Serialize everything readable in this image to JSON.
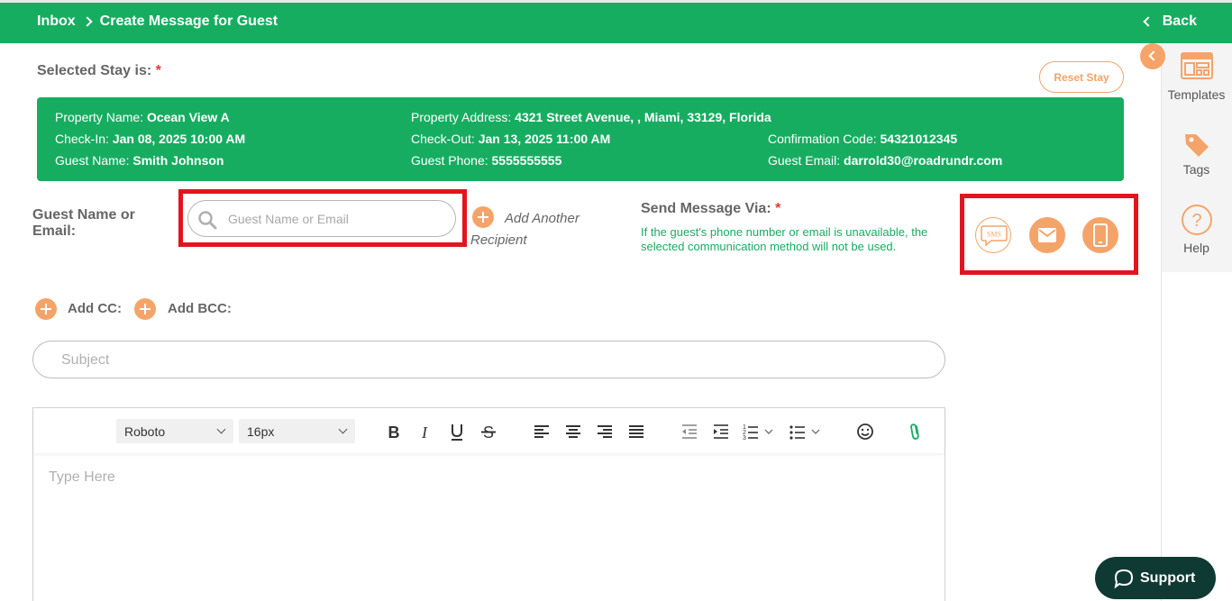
{
  "header": {
    "breadcrumb_root": "Inbox",
    "page_title": "Create Message for Guest",
    "back_label": "Back"
  },
  "sidebar": {
    "items": [
      {
        "label": "Templates",
        "icon": "templates-icon"
      },
      {
        "label": "Tags",
        "icon": "tag-icon"
      },
      {
        "label": "Help",
        "icon": "help-icon"
      }
    ]
  },
  "stay": {
    "selected_label": "Selected Stay is:",
    "required_mark": "*",
    "reset_label": "Reset Stay",
    "property_name_label": "Property Name:",
    "property_name": "Ocean View A",
    "property_address_label": "Property Address:",
    "property_address": "4321 Street Avenue, , Miami, 33129, Florida",
    "checkin_label": "Check-In:",
    "checkin": "Jan 08, 2025 10:00 AM",
    "checkout_label": "Check-Out:",
    "checkout": "Jan 13, 2025 11:00 AM",
    "confirmation_label": "Confirmation Code:",
    "confirmation": "54321012345",
    "guest_name_label": "Guest Name:",
    "guest_name": "Smith Johnson",
    "guest_phone_label": "Guest Phone:",
    "guest_phone": "5555555555",
    "guest_email_label": "Guest Email:",
    "guest_email": "darrold30@roadrundr.com"
  },
  "recipient": {
    "label": "Guest Name or Email:",
    "placeholder": "Guest Name or Email",
    "value": "",
    "add_another": "Add Another Recipient"
  },
  "send_via": {
    "label": "Send Message Via:",
    "required_mark": "*",
    "note": "If the guest's phone number or email is unavailable, the selected communication method will not be used.",
    "sms_text": "SMS",
    "options": [
      "sms-icon",
      "email-icon",
      "phone-icon"
    ]
  },
  "cc": {
    "add_cc": "Add CC:",
    "add_bcc": "Add BCC:"
  },
  "subject": {
    "placeholder": "Subject",
    "value": ""
  },
  "editor": {
    "font": "Roboto",
    "size": "16px",
    "placeholder": "Type Here"
  },
  "support": {
    "label": "Support"
  },
  "colors": {
    "brand_green": "#17ad61",
    "accent_orange": "#f5a469",
    "highlight_red": "#e3141e",
    "support_dark": "#0f3a34"
  }
}
